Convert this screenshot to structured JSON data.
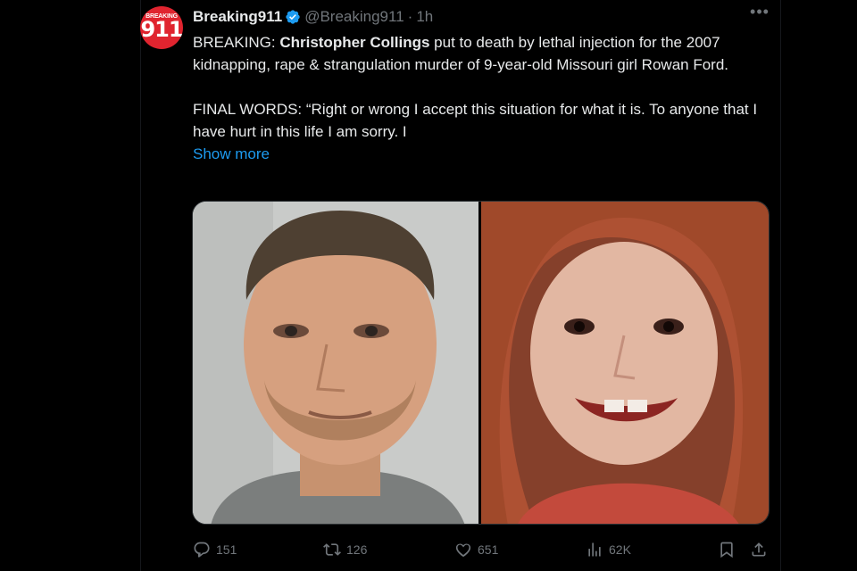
{
  "tweet": {
    "avatar": {
      "top_text": "BREAKING",
      "number": "911"
    },
    "display_name": "Breaking911",
    "handle": "@Breaking911",
    "separator": "·",
    "time": "1h",
    "more_label": "•••",
    "text": {
      "prefix": "BREAKING: ",
      "bold_name": "Christopher Collings",
      "line1_rest": " put to death by lethal injection for the 2007 kidnapping, rape & strangulation murder of 9-year-old Missouri girl Rowan Ford.",
      "final_words": "FINAL WORDS: “Right or wrong I accept this situation for what it is. To anyone that I have hurt in this life I am sorry. I",
      "show_more": "Show more"
    },
    "media": {
      "left_icon": "man-portrait-photo",
      "right_icon": "girl-portrait-photo"
    },
    "actions": {
      "replies": "151",
      "reposts": "126",
      "likes": "651",
      "views": "62K"
    }
  },
  "colors": {
    "background": "#000000",
    "text": "#e7e9ea",
    "secondary": "#71767b",
    "link": "#1d9bf0",
    "verified": "#1d9bf0",
    "avatar_red": "#e0242f"
  }
}
